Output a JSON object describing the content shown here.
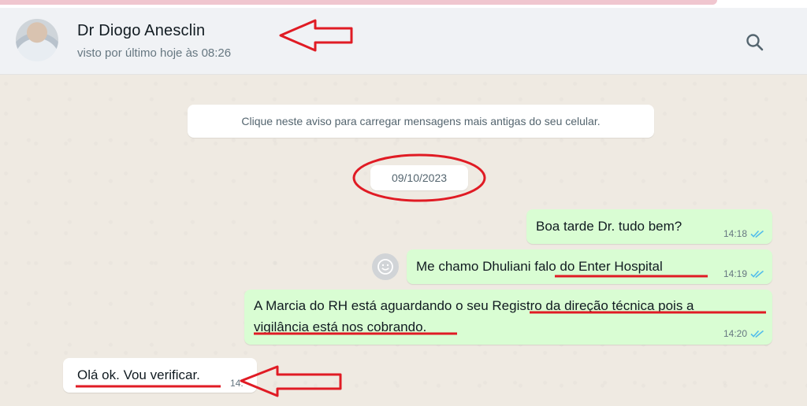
{
  "header": {
    "contact_name": "Dr Diogo Anesclin",
    "last_seen": "visto por último hoje às 08:26",
    "search_icon": "search-icon"
  },
  "chat": {
    "notice": "Clique neste aviso para carregar mensagens mais antigas do seu celular.",
    "date": "09/10/2023",
    "messages": [
      {
        "direction": "out",
        "text": "Boa tarde Dr. tudo bem?",
        "time": "14:18",
        "status": "read"
      },
      {
        "direction": "out",
        "text": "Me chamo Dhuliani falo do Enter Hospital",
        "time": "14:19",
        "status": "read"
      },
      {
        "direction": "out",
        "line1": "A Marcia do RH está aguardando o seu Registro da direção técnica pois a",
        "line2": "vigilância está nos cobrando.",
        "time": "14:20",
        "status": "read"
      },
      {
        "direction": "in",
        "text": "Olá ok. Vou verificar.",
        "time": "14:"
      }
    ]
  },
  "colors": {
    "outgoing_bubble": "#d9fdd3",
    "incoming_bubble": "#ffffff",
    "chat_background": "#efeae2",
    "read_tick": "#53bdeb",
    "annotation_red": "#e01b24"
  }
}
